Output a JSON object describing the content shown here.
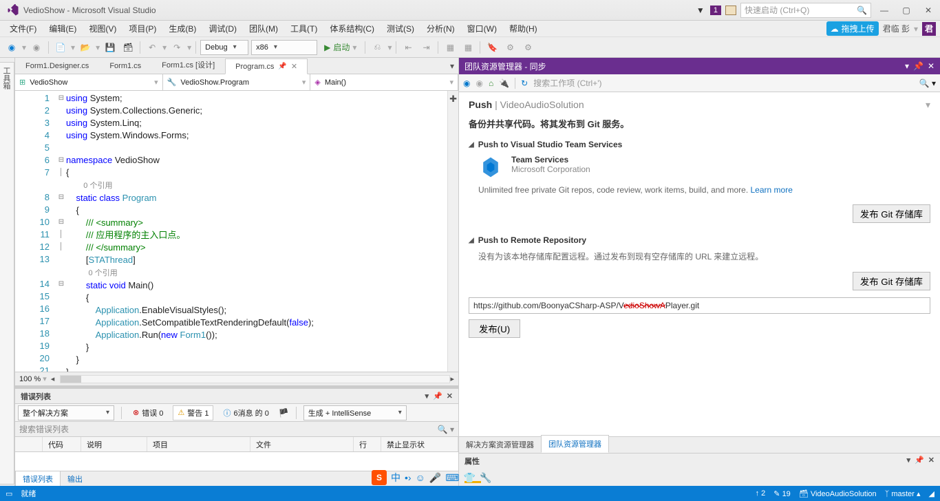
{
  "title": "VedioShow - Microsoft Visual Studio",
  "notifications": "1",
  "quicklaunch_placeholder": "快速启动 (Ctrl+Q)",
  "menu": [
    "文件(F)",
    "编辑(E)",
    "视图(V)",
    "项目(P)",
    "生成(B)",
    "调试(D)",
    "团队(M)",
    "工具(T)",
    "体系结构(C)",
    "测试(S)",
    "分析(N)",
    "窗口(W)",
    "帮助(H)"
  ],
  "upload_badge": "拖拽上传",
  "user_name": "君临 彭",
  "user_initial": "君",
  "config": "Debug",
  "platform": "x86",
  "start_label": "启动",
  "tabs": [
    {
      "label": "Form1.Designer.cs"
    },
    {
      "label": "Form1.cs"
    },
    {
      "label": "Form1.cs [设计]"
    },
    {
      "label": "Program.cs",
      "active": true
    }
  ],
  "nav1": "VedioShow",
  "nav2": "VedioShow.Program",
  "nav3": "Main()",
  "code_lines": [
    "using System;",
    "using System.Collections.Generic;",
    "using System.Linq;",
    "using System.Windows.Forms;",
    "",
    "namespace VedioShow",
    "{",
    "0 个引用",
    "    static class Program",
    "    {",
    "        /// <summary>",
    "        /// 应用程序的主入口点。",
    "        /// </summary>",
    "        [STAThread]",
    "0 个引用",
    "        static void Main()",
    "        {",
    "            Application.EnableVisualStyles();",
    "            Application.SetCompatibleTextRenderingDefault(false);",
    "            Application.Run(new Form1());",
    "        }",
    "    }",
    "}",
    ""
  ],
  "zoom": "100 %",
  "errorlist": {
    "title": "错误列表",
    "scope": "整个解决方案",
    "errors_label": "错误 0",
    "warnings_label": "警告 1",
    "messages_label": "6消息 的 0",
    "build_label": "生成 + IntelliSense",
    "search_placeholder": "搜索错误列表",
    "columns": [
      "",
      "代码",
      "说明",
      "项目",
      "文件",
      "行",
      "禁止显示状"
    ]
  },
  "bottom_tabs": {
    "errors": "错误列表",
    "output": "输出"
  },
  "team": {
    "header": "团队资源管理器 - 同步",
    "search_placeholder": "搜索工作项 (Ctrl+')",
    "push": "Push",
    "solution": "VideoAudioSolution",
    "backup_msg": "备份并共享代码。将其发布到 Git 服务。",
    "sec1": "Push to Visual Studio Team Services",
    "ts_name": "Team Services",
    "ts_corp": "Microsoft Corporation",
    "ts_desc": "Unlimited free private Git repos, code review, work items, build, and more. ",
    "learn_more": "Learn more",
    "pub_git": "发布 Git 存储库",
    "sec2": "Push to Remote Repository",
    "remote_desc": "没有为该本地存储库配置远程。通过发布到现有空存储库的 URL 来建立远程。",
    "url_pre": "https://github.com/BoonyaCSharp-ASP/V",
    "url_red": "edioShowA",
    "url_post": "Player.git",
    "publish": "发布(U)"
  },
  "right_tabs": {
    "solution": "解决方案资源管理器",
    "team": "团队资源管理器"
  },
  "props_title": "属性",
  "status": {
    "ready": "就绪",
    "up": "2",
    "pending": "19",
    "repo": "VideoAudioSolution",
    "branch": "master"
  },
  "ime": {
    "s": "S",
    "zhong": "中"
  }
}
